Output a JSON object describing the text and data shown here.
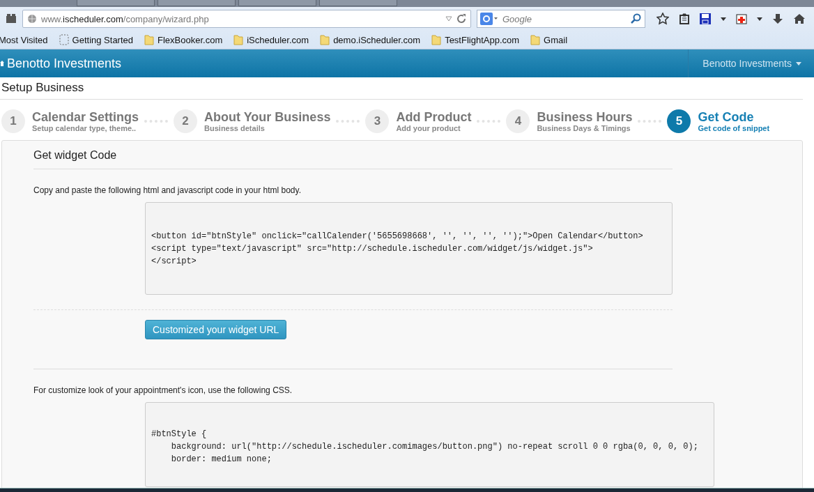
{
  "browser": {
    "url": "www.**ischeduler.com**/company/wizard.php",
    "search_placeholder": "Google",
    "bookmarks": [
      {
        "label": "Most Visited",
        "kind": "plain"
      },
      {
        "label": "Getting Started",
        "kind": "dashed"
      },
      {
        "label": "FlexBooker.com",
        "kind": "folder"
      },
      {
        "label": "iScheduler.com",
        "kind": "folder"
      },
      {
        "label": "demo.iScheduler.com",
        "kind": "folder"
      },
      {
        "label": "TestFlightApp.com",
        "kind": "folder"
      },
      {
        "label": "Gmail",
        "kind": "folder"
      }
    ]
  },
  "navbar": {
    "brand": "Benotto Investments",
    "user_menu": "Benotto Investments"
  },
  "page_title": "Setup Business",
  "steps": [
    {
      "number": "1",
      "title": "Calendar Settings",
      "subtitle": "Setup calendar type, theme..",
      "selected": false
    },
    {
      "number": "2",
      "title": "About Your Business",
      "subtitle": "Business details",
      "selected": false
    },
    {
      "number": "3",
      "title": "Add Product",
      "subtitle": "Add your product",
      "selected": false
    },
    {
      "number": "4",
      "title": "Business Hours",
      "subtitle": "Business Days & Timings",
      "selected": false
    },
    {
      "number": "5",
      "title": "Get Code",
      "subtitle": "Get code of snippet",
      "selected": true
    }
  ],
  "panel": {
    "heading": "Get widget Code",
    "intro": "Copy and paste the following html and javascript code in your html body.",
    "html_code": [
      "<button id=\"btnStyle\" onclick=\"callCalender('5655698668', '', '', '', '');\">Open Calendar</button>",
      "<script type=\"text/javascript\" src=\"http://schedule.ischeduler.com/widget/js/widget.js\">",
      "</script>"
    ],
    "button": "Customized your widget URL",
    "css_intro": "For customize look of your appointment's icon, use the following CSS.",
    "css_code": [
      "#btnStyle {",
      "    background: url(\"http://schedule.ischeduler.comimages/button.png\") no-repeat scroll 0 0 rgba(0, 0, 0, 0);",
      "    border: medium none;"
    ]
  }
}
